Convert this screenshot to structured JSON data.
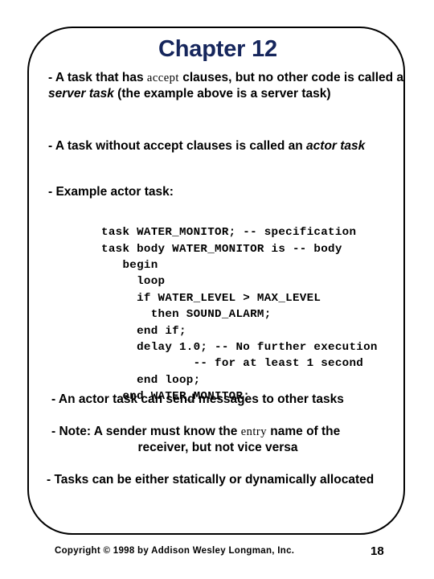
{
  "slide": {
    "title": "Chapter 12",
    "bullets": {
      "server_task": {
        "marker": "- ",
        "seg1": "A task that has ",
        "keyword": "accept",
        "seg2": " clauses, but no other code is called a ",
        "emphasis": "server task",
        "seg3": " (the example above is a server task)"
      },
      "actor_task": {
        "marker": "- ",
        "seg1": "A task without accept clauses is called an ",
        "emphasis": "actor task"
      },
      "example_heading": {
        "marker": "- ",
        "seg1": "Example actor task:"
      },
      "send_messages": {
        "marker": "- ",
        "seg1": "An actor task can send messages to other tasks"
      },
      "entry_name": {
        "marker": "- ",
        "seg1": "Note: A sender must know the ",
        "keyword": "entry",
        "seg2": " name of the ",
        "line2": "receiver, but not vice versa"
      },
      "allocated": {
        "marker": "- ",
        "seg1": "Tasks can be either statically or dynamically allocated"
      }
    },
    "code": "task WATER_MONITOR; -- specification\ntask body WATER_MONITOR is -- body\n   begin\n     loop\n     if WATER_LEVEL > MAX_LEVEL\n       then SOUND_ALARM;\n     end if;\n     delay 1.0; -- No further execution\n             -- for at least 1 second\n     end loop;\n   end WATER_MONITOR;"
  },
  "footer": {
    "copyright": "Copyright © 1998 by Addison Wesley Longman, Inc.",
    "page_number": "18"
  },
  "colors": {
    "title": "#16265c",
    "text": "#000000",
    "frame_border": "#000000",
    "background": "#ffffff"
  }
}
